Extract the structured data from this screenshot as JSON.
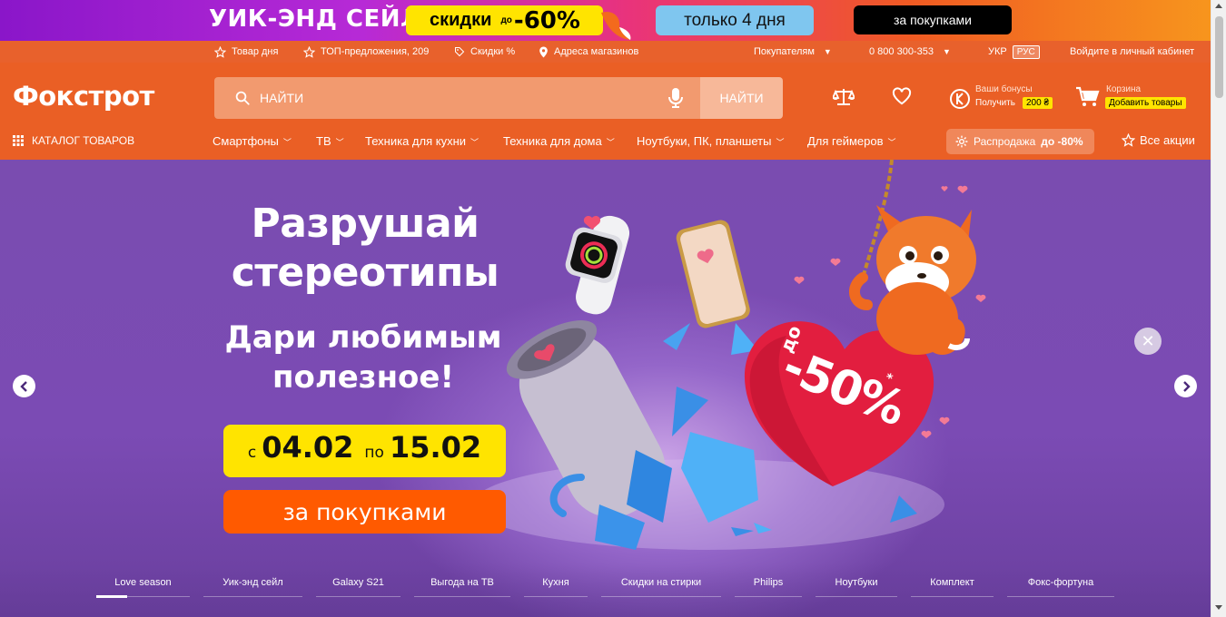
{
  "promo": {
    "title": "УИК-ЭНД СЕЙЛ",
    "discount_label": "скидки",
    "discount_prefix": "до",
    "discount_value": "-60%",
    "days": "только 4 дня",
    "cta": "за покупками"
  },
  "topbar": {
    "product_of_day": "Товар дня",
    "top_offers": "ТОП-предложения, 209",
    "discounts": "Скидки %",
    "store_addresses": "Адреса магазинов",
    "customers": "Покупателям",
    "phone": "0 800 300-353",
    "lang_ukr": "УКР",
    "lang_rus": "РУС",
    "login": "Войдите в личный кабинет"
  },
  "header": {
    "logo": "Фокстрот",
    "search_placeholder": "НАЙТИ",
    "search_button": "НАЙТИ",
    "bonus_title": "Ваши бонусы",
    "bonus_get": "Получить",
    "bonus_amount": "200 ₴",
    "cart_title": "Корзина",
    "cart_add": "Добавить товары"
  },
  "nav": {
    "catalog": "КАТАЛОГ ТОВАРОВ",
    "items": [
      "Смартфоны",
      "ТВ",
      "Техника для кухни",
      "Техника для дома",
      "Ноутбуки, ПК, планшеты",
      "Для геймеров"
    ],
    "sale_prefix": "Распродажа",
    "sale_value": "до -80%",
    "all_promos": "Все акции"
  },
  "hero": {
    "title_line1": "Разрушай",
    "title_line2": "стереотипы",
    "subtitle_line1": "Дари любимым",
    "subtitle_line2": "полезное!",
    "date_from_prefix": "с",
    "date_from": "04.02",
    "date_to_prefix": "по",
    "date_to": "15.02",
    "cta": "за покупками",
    "heart_prefix": "до",
    "heart_value": "-50%",
    "heart_asterisk": "*",
    "close_glyph": "✕"
  },
  "tabs": [
    "Love season",
    "Уик-энд сейл",
    "Galaxy S21",
    "Выгода на ТВ",
    "Кухня",
    "Скидки на стирки",
    "Philips",
    "Ноутбуки",
    "Комплект",
    "Фокс-фортуна"
  ],
  "colors": {
    "brand_orange": "#ea5f25",
    "promo_yellow": "#ffe400",
    "hero_purple": "#7b4bb4",
    "cta_orange": "#ff5a00"
  }
}
